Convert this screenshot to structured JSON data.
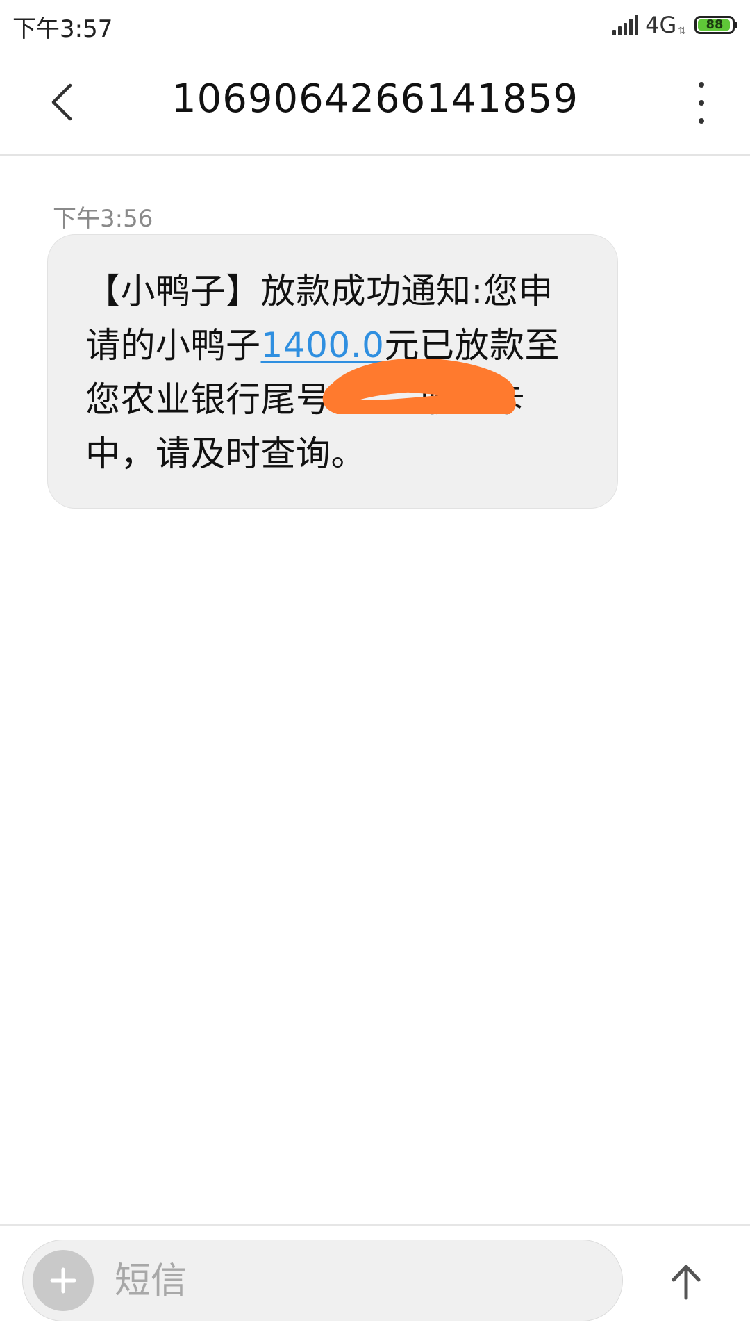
{
  "status_bar": {
    "time": "下午3:57",
    "network": "4G",
    "battery_level": "88",
    "battery_color": "#5fc738"
  },
  "header": {
    "title": "1069064266141859",
    "back_icon": "chevron-left-icon",
    "more_icon": "more-vertical-icon"
  },
  "conversation": {
    "messages": [
      {
        "time": "下午3:56",
        "text_before": "【小鸭子】放款成功通知:您申请的小鸭子",
        "amount": "1400.0",
        "text_after": "元已放款至您农业银行尾号",
        "text_hidden_end": "收款卡中，请及时查询。",
        "redaction_color": "#ff7a2e",
        "link_color": "#2f8fe0"
      }
    ]
  },
  "compose": {
    "placeholder": "短信",
    "add_icon": "plus-icon",
    "send_icon": "arrow-up-icon"
  }
}
